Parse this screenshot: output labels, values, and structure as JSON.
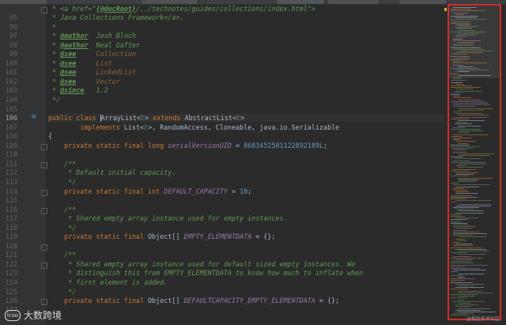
{
  "watermark": {
    "logo": "lcoo",
    "text": "大数跨境"
  },
  "watermark_right": "@掘金技术社区",
  "lines": [
    {
      "n": "",
      "html": "&nbsp;* &lt;a href=\"<span class=\"doctag\">{@docRoot}</span><span class=\"doc\">/../technotes/guides/collections/index.html\"&gt;</span>",
      "cls": "doc"
    },
    {
      "n": "95",
      "html": " * Java Collections Framework&lt;/a&gt;.",
      "cls": "doc"
    },
    {
      "n": "96",
      "html": " *",
      "cls": "doc"
    },
    {
      "n": "97",
      "html": " * <span class=\"doctag\">@author</span>  Josh Bloch",
      "cls": "doc"
    },
    {
      "n": "98",
      "html": " * <span class=\"doctag\">@author</span>  Neal Gafter",
      "cls": "doc"
    },
    {
      "n": "99",
      "html": " * <span class=\"doctag\">@see</span>     <span class=\"docref\">Collection</span>",
      "cls": "doc"
    },
    {
      "n": "100",
      "html": " * <span class=\"doctag\">@see</span>     <span class=\"docref\">List</span>",
      "cls": "doc"
    },
    {
      "n": "101",
      "html": " * <span class=\"doctag\">@see</span>     <span class=\"docref\">LinkedList</span>",
      "cls": "doc"
    },
    {
      "n": "102",
      "html": " * <span class=\"doctag\">@see</span>     <span class=\"docref\">Vector</span>",
      "cls": "doc"
    },
    {
      "n": "103",
      "html": " * <span class=\"doctag\">@since</span>   1.2",
      "cls": "doc"
    },
    {
      "n": "104",
      "html": " */",
      "cls": "doc"
    },
    {
      "n": "105",
      "html": "",
      "cls": ""
    },
    {
      "n": "106",
      "html": "<span class=\"kw\">public class </span><span class=\"cursor\"></span>ArrayList&lt;<span class=\"type-param\">E</span>&gt; <span class=\"kw\">extends </span>AbstractList&lt;<span class=\"type-param\">E</span>&gt;",
      "cls": "",
      "current": true
    },
    {
      "n": "107",
      "html": "        <span class=\"kw\">implements </span>List&lt;<span class=\"type-param\">E</span>&gt;, RandomAccess, Cloneable, java.io.Serializable",
      "cls": ""
    },
    {
      "n": "108",
      "html": "{",
      "cls": ""
    },
    {
      "n": "109",
      "html": "    <span class=\"kw\">private static final long </span><span class=\"field\">serialVersionUID</span> = <span class=\"num\">8683452581122892189L</span>;",
      "cls": ""
    },
    {
      "n": "110",
      "html": "",
      "cls": ""
    },
    {
      "n": "111",
      "html": "    /**",
      "cls": "doc"
    },
    {
      "n": "112",
      "html": "     * Default initial capacity.",
      "cls": "doc"
    },
    {
      "n": "113",
      "html": "     */",
      "cls": "doc"
    },
    {
      "n": "114",
      "html": "    <span class=\"kw\">private static final int </span><span class=\"field\">DEFAULT_CAPACITY</span> = <span class=\"num\">10</span>;",
      "cls": ""
    },
    {
      "n": "115",
      "html": "",
      "cls": ""
    },
    {
      "n": "116",
      "html": "    /**",
      "cls": "doc"
    },
    {
      "n": "117",
      "html": "     * Shared empty array instance used for empty instances.",
      "cls": "doc"
    },
    {
      "n": "118",
      "html": "     */",
      "cls": "doc"
    },
    {
      "n": "119",
      "html": "    <span class=\"kw\">private static final </span>Object[] <span class=\"field\">EMPTY_ELEMENTDATA</span> = {};",
      "cls": ""
    },
    {
      "n": "120",
      "html": "",
      "cls": ""
    },
    {
      "n": "121",
      "html": "    /**",
      "cls": "doc"
    },
    {
      "n": "122",
      "html": "     * Shared empty array instance used for default sized empty instances. We",
      "cls": "doc"
    },
    {
      "n": "123",
      "html": "     * distinguish this from EMPTY_ELEMENTDATA to know how much to inflate when",
      "cls": "doc"
    },
    {
      "n": "124",
      "html": "     * first element is added.",
      "cls": "doc"
    },
    {
      "n": "125",
      "html": "     */",
      "cls": "doc"
    },
    {
      "n": "126",
      "html": "    <span class=\"kw\">private static final </span>Object[] <span class=\"field\">DEFAULTCAPACITY_EMPTY_ELEMENTDATA</span> = {};",
      "cls": ""
    },
    {
      "n": "127",
      "html": "",
      "cls": ""
    }
  ]
}
